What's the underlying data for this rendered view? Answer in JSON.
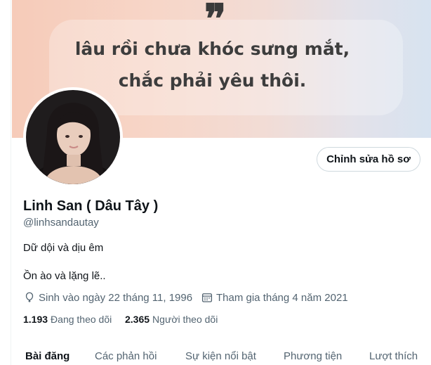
{
  "banner": {
    "quote_mark": "❞",
    "line1": "lâu rồi chưa khóc sưng mắt,",
    "line2": "chắc phải yêu thôi."
  },
  "profile": {
    "edit_label": "Chỉnh sửa hồ sơ",
    "name": "Linh San ( Dâu Tây )",
    "handle": "@linhsandautay",
    "bio_line1": "Dữ dội và dịu êm",
    "bio_line2": "Ồn ào và lặng lẽ..",
    "birth": "Sinh vào ngày 22 tháng 11, 1996",
    "joined": "Tham gia tháng 4 năm 2021",
    "following_count": "1.193",
    "following_label": "Đang theo dõi",
    "followers_count": "2.365",
    "followers_label": "Người theo dõi"
  },
  "tabs": {
    "posts": "Bài đăng",
    "replies": "Các phản hồi",
    "highlights": "Sự kiện nổi bật",
    "media": "Phương tiện",
    "likes": "Lượt thích"
  },
  "icons": {
    "birth": "balloon-icon",
    "joined": "calendar-icon"
  },
  "colors": {
    "text_primary": "#0f1419",
    "text_secondary": "#536471",
    "border": "#cfd9de"
  }
}
